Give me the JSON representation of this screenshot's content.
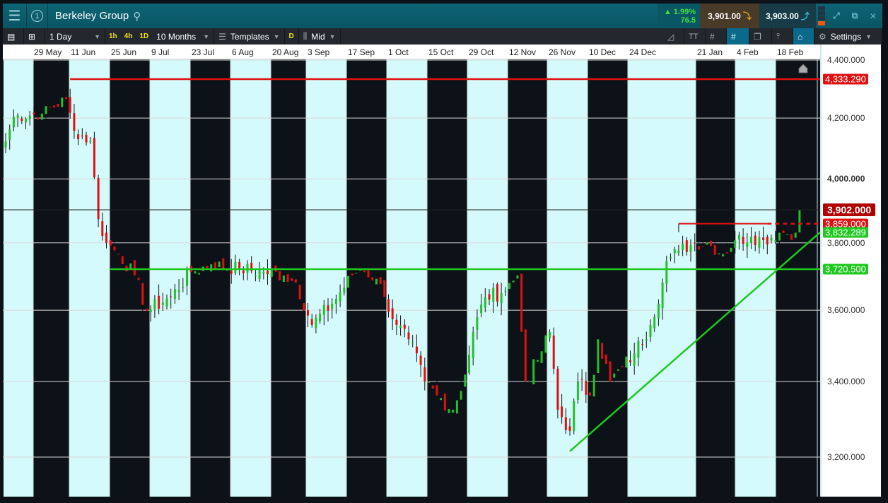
{
  "header": {
    "instrument": "Berkeley Group",
    "change_pct": "▲ 1.99%",
    "change_pts": "76.5",
    "sell_price": "3,901.00",
    "buy_price": "3,903.00"
  },
  "toolbar": {
    "interval": "1 Day",
    "quick_1h": "1h",
    "quick_4h": "4h",
    "quick_1d": "1D",
    "range": "10 Months",
    "templates": "Templates",
    "d_label": "D",
    "price_type": "Mid",
    "settings": "Settings",
    "typo_icon": "TT"
  },
  "colors": {
    "up": "#22c02a",
    "down": "#e01010",
    "band": "#d4fafb",
    "teal": "#0b5f6e"
  },
  "chart_data": {
    "type": "candlestick",
    "title": "Berkeley Group",
    "x_tick_labels": [
      "29 May",
      "11 Jun",
      "25 Jun",
      "9 Jul",
      "23 Jul",
      "6 Aug",
      "20 Aug",
      "3 Sep",
      "17 Sep",
      "1 Oct",
      "15 Oct",
      "29 Oct",
      "12 Nov",
      "26 Nov",
      "10 Dec",
      "24 Dec",
      "21 Jan",
      "4 Feb",
      "18 Feb"
    ],
    "y_ticks": [
      {
        "v": 4400,
        "label": "4,400.000"
      },
      {
        "v": 4200,
        "label": "4,200.000"
      },
      {
        "v": 4000,
        "label": "4,000.000"
      },
      {
        "v": 3800,
        "label": "3,800.000"
      },
      {
        "v": 3600,
        "label": "3,600.000"
      },
      {
        "v": 3400,
        "label": "3,400.000"
      },
      {
        "v": 3200,
        "label": "3,200.000"
      }
    ],
    "y_scale": "log",
    "ylim": [
      3100,
      4430
    ],
    "close_anchors_by_trading_day": [
      [
        0,
        4122
      ],
      [
        2,
        4205
      ],
      [
        9,
        4215
      ],
      [
        15,
        4265
      ],
      [
        17,
        4157
      ],
      [
        21,
        4122
      ],
      [
        23,
        3873
      ],
      [
        25,
        3800
      ],
      [
        28,
        3766
      ],
      [
        32,
        3702
      ],
      [
        35,
        3598
      ],
      [
        41,
        3639
      ],
      [
        46,
        3712
      ],
      [
        51,
        3735
      ],
      [
        58,
        3722
      ],
      [
        64,
        3712
      ],
      [
        69,
        3702
      ],
      [
        72,
        3681
      ],
      [
        76,
        3558
      ],
      [
        81,
        3619
      ],
      [
        86,
        3702
      ],
      [
        88,
        3722
      ],
      [
        92,
        3692
      ],
      [
        94,
        3639
      ],
      [
        97,
        3558
      ],
      [
        100,
        3517
      ],
      [
        104,
        3400
      ],
      [
        107,
        3362
      ],
      [
        111,
        3324
      ],
      [
        114,
        3419
      ],
      [
        116,
        3538
      ],
      [
        119,
        3639
      ],
      [
        123,
        3650
      ],
      [
        127,
        3702
      ],
      [
        128,
        3538
      ],
      [
        129,
        3400
      ],
      [
        132,
        3459
      ],
      [
        135,
        3538
      ],
      [
        137,
        3324
      ],
      [
        140,
        3268
      ],
      [
        142,
        3400
      ],
      [
        145,
        3362
      ],
      [
        147,
        3517
      ],
      [
        150,
        3400
      ],
      [
        153,
        3439
      ],
      [
        156,
        3478
      ],
      [
        160,
        3558
      ],
      [
        163,
        3681
      ],
      [
        164,
        3744
      ],
      [
        167,
        3776
      ],
      [
        171,
        3800
      ],
      [
        174,
        3800
      ],
      [
        178,
        3766
      ],
      [
        181,
        3808
      ],
      [
        185,
        3819
      ],
      [
        188,
        3808
      ],
      [
        192,
        3831
      ],
      [
        196,
        3831
      ],
      [
        197,
        3902
      ]
    ],
    "levels": [
      {
        "name": "resistance-high",
        "value": 4333.29,
        "label": "4,333.290",
        "color": "#e01010",
        "from_day": 16
      },
      {
        "name": "current-price",
        "value": 3902,
        "label": "3,902.000",
        "color": "#b00000"
      },
      {
        "name": "resistance-range",
        "value": 3859,
        "label": "3,859.000",
        "color": "#e01010",
        "from_day": 167,
        "dashed_from_day": 189
      },
      {
        "name": "support",
        "value": 3720.5,
        "label": "3,720.500",
        "color": "#1ec81e",
        "from_day": 26
      }
    ],
    "trendline": {
      "label": "3,832.289",
      "color": "#1ec81e",
      "start": {
        "day": 140,
        "value": 3215
      },
      "end_value": 3832.289
    }
  }
}
